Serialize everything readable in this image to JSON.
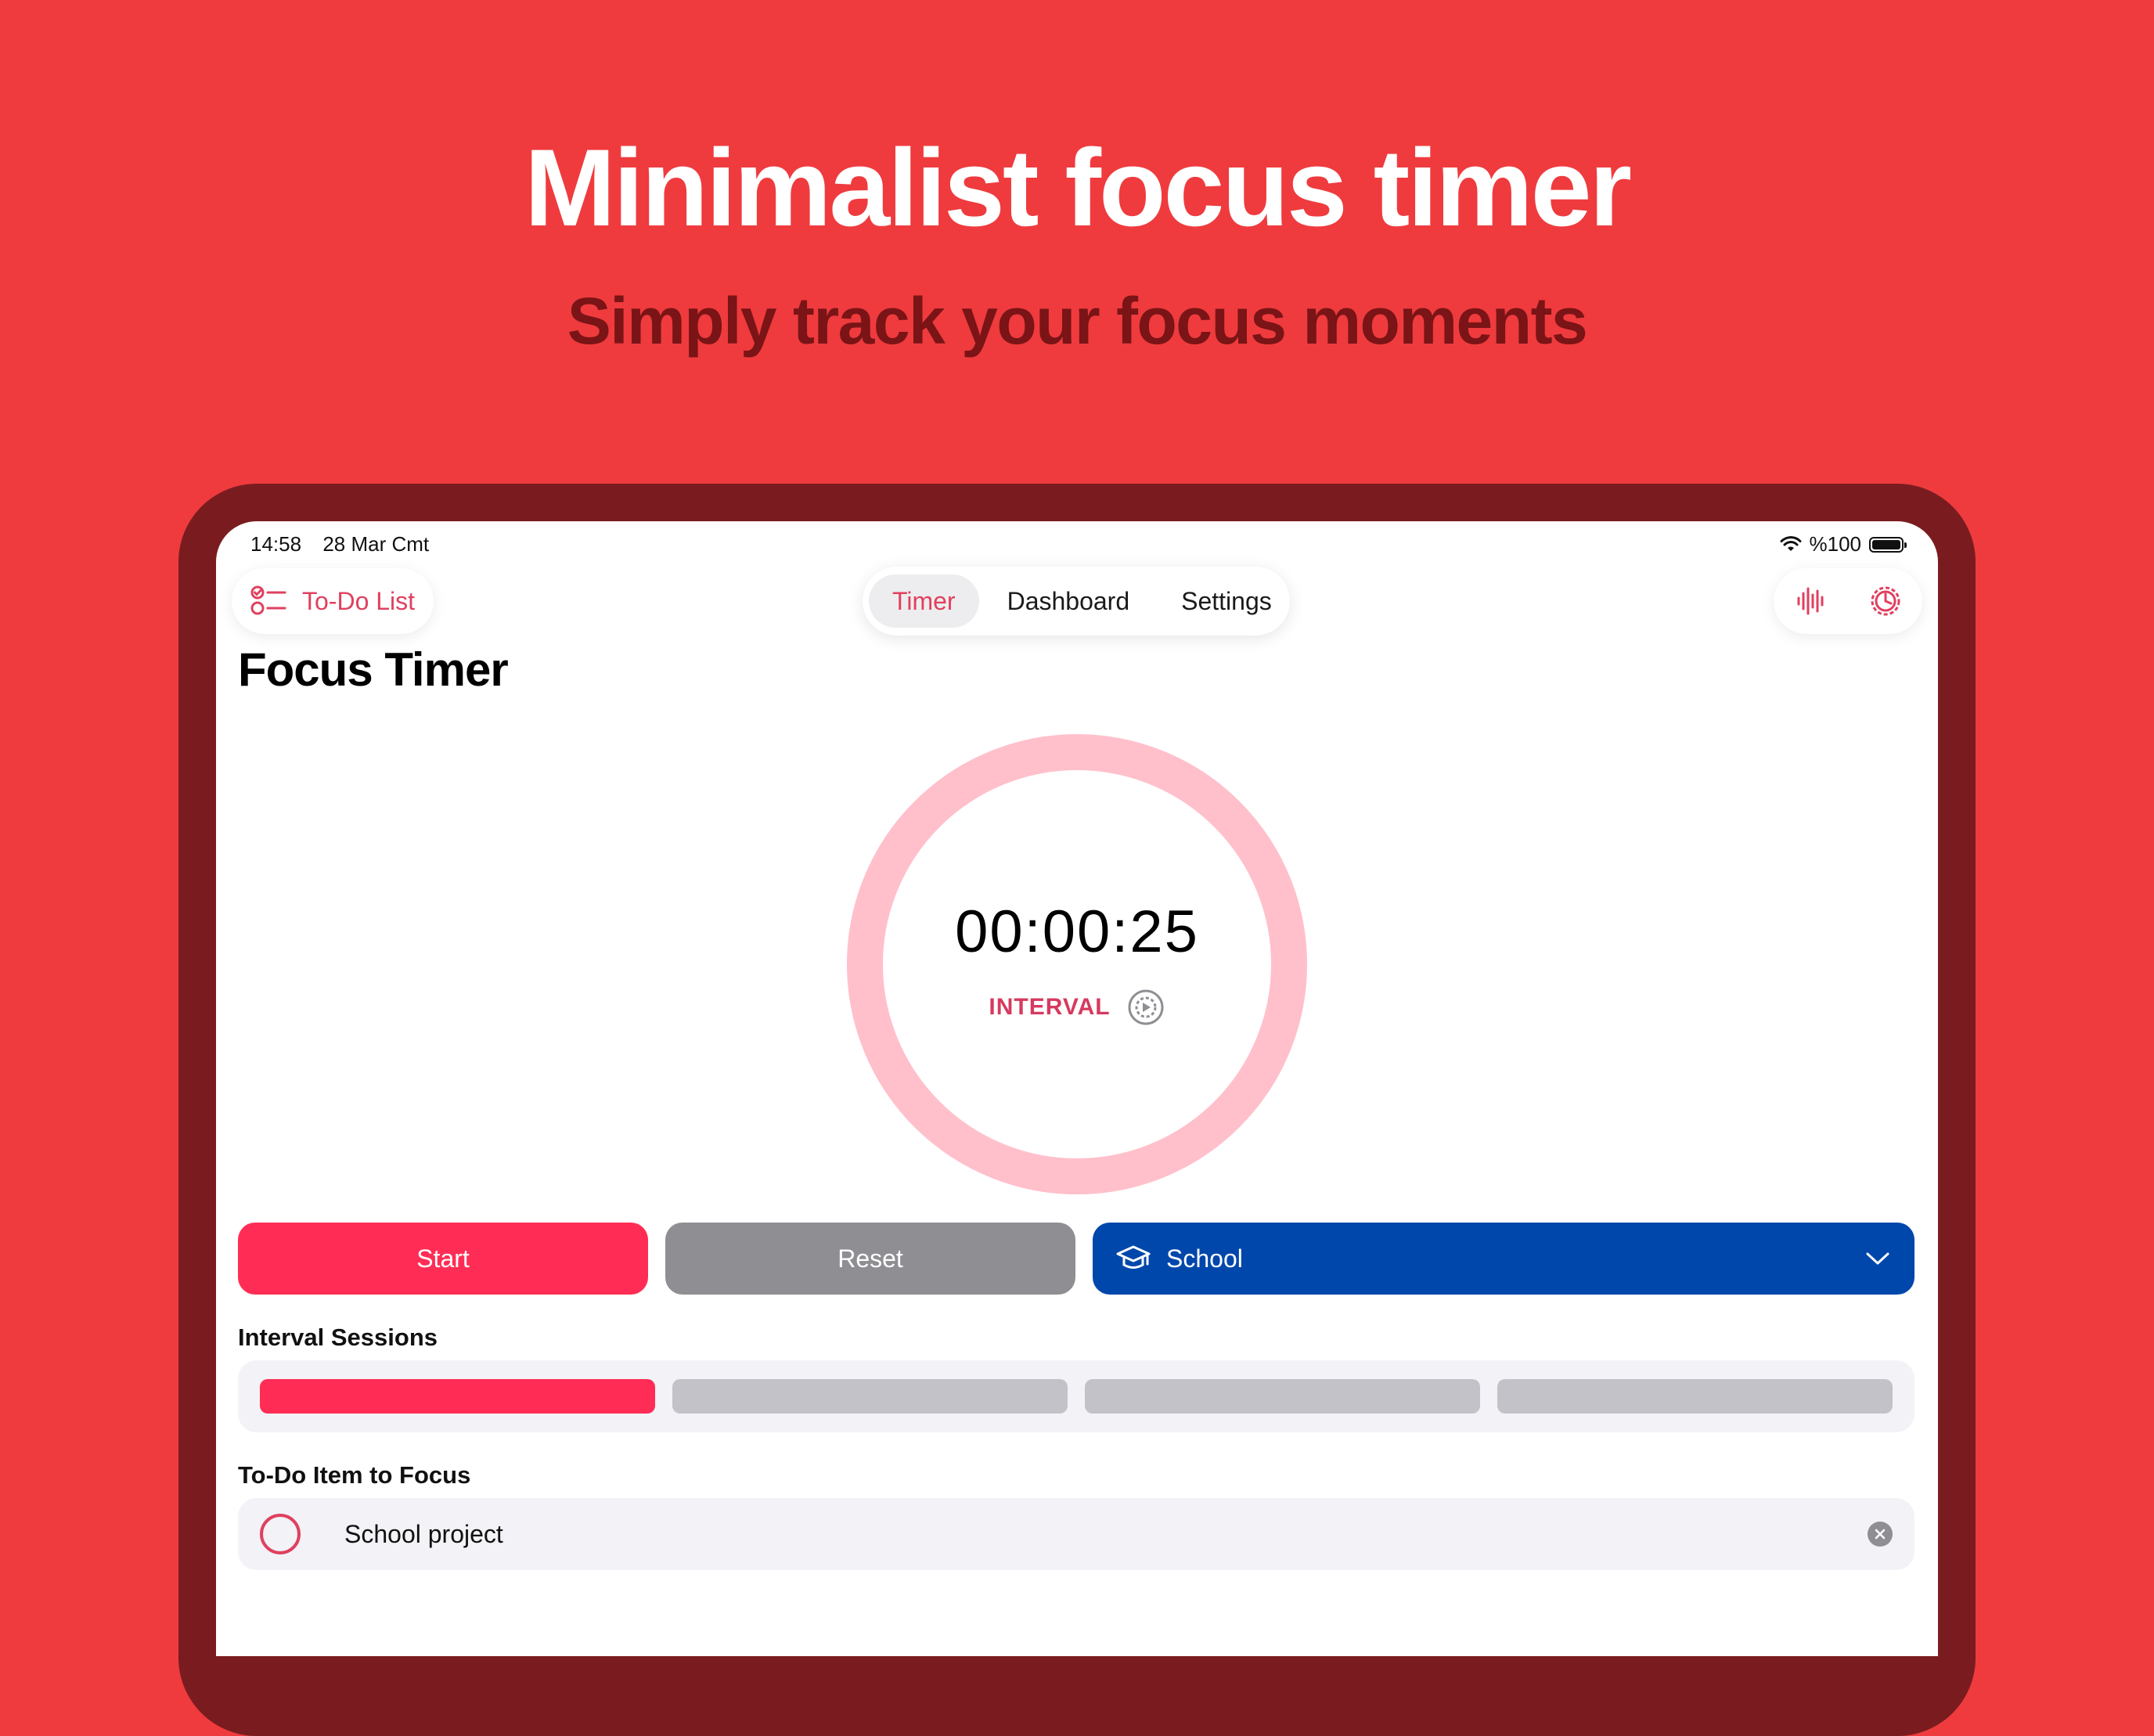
{
  "marketing": {
    "headline": "Minimalist focus timer",
    "subheadline": "Simply track your focus moments"
  },
  "status_bar": {
    "time": "14:58",
    "date": "28 Mar Cmt",
    "battery": "%100"
  },
  "nav": {
    "todo_label": "To-Do List",
    "tabs": [
      {
        "label": "Timer",
        "active": true
      },
      {
        "label": "Dashboard",
        "active": false
      },
      {
        "label": "Settings",
        "active": false
      }
    ],
    "tool_icons": [
      "waveform-icon",
      "timer-settings-icon"
    ]
  },
  "page": {
    "title": "Focus Timer"
  },
  "timer": {
    "time": "00:00:25",
    "mode": "INTERVAL",
    "progress": 0.0
  },
  "actions": {
    "start_label": "Start",
    "reset_label": "Reset",
    "category_label": "School"
  },
  "sessions": {
    "label": "Interval Sessions",
    "total": 4,
    "completed": 1
  },
  "todo_focus": {
    "label": "To-Do Item to Focus",
    "item": "School project"
  },
  "colors": {
    "background": "#EF3B3E",
    "accent": "#FF2D55",
    "ring": "#FFC0CB",
    "category": "#0047AB",
    "neutral_button": "#8E8E93"
  }
}
